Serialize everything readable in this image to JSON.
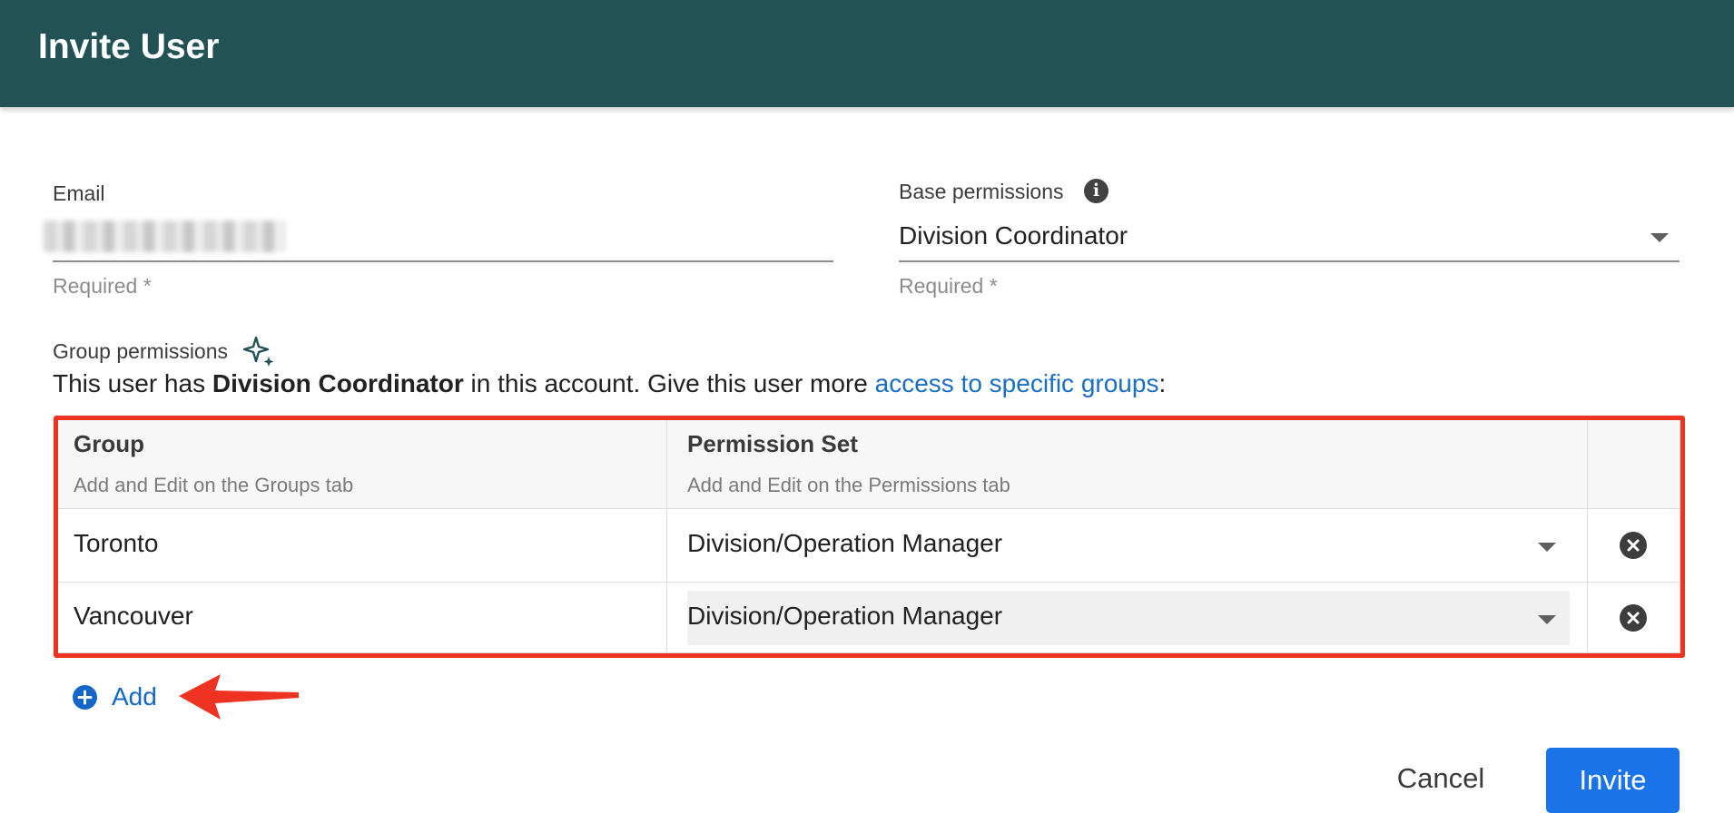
{
  "header": {
    "title": "Invite User"
  },
  "email": {
    "label": "Email",
    "helper": "Required *"
  },
  "base_permissions": {
    "label": "Base permissions",
    "value": "Division Coordinator",
    "helper": "Required *"
  },
  "group_permissions": {
    "label": "Group permissions",
    "description_prefix": "This user has ",
    "description_role": "Division Coordinator",
    "description_middle": " in this account. Give this user more ",
    "description_link": "access to specific groups",
    "description_suffix": ":"
  },
  "table": {
    "columns": [
      {
        "title": "Group",
        "subtitle": "Add and Edit on the Groups tab"
      },
      {
        "title": "Permission Set",
        "subtitle": "Add and Edit on the Permissions tab"
      }
    ],
    "rows": [
      {
        "group": "Toronto",
        "permission_set": "Division/Operation Manager"
      },
      {
        "group": "Vancouver",
        "permission_set": "Division/Operation Manager"
      }
    ]
  },
  "actions": {
    "add_label": "Add",
    "cancel_label": "Cancel",
    "invite_label": "Invite"
  },
  "colors": {
    "header_bg": "#235256",
    "accent": "#1a73e8",
    "link": "#1a6fc4",
    "highlight": "#ee3322"
  },
  "icons": {
    "info": "info-icon",
    "sparkle": "sparkle-icon",
    "remove": "remove-circle-icon",
    "add": "add-circle-icon",
    "caret": "chevron-down-icon"
  }
}
